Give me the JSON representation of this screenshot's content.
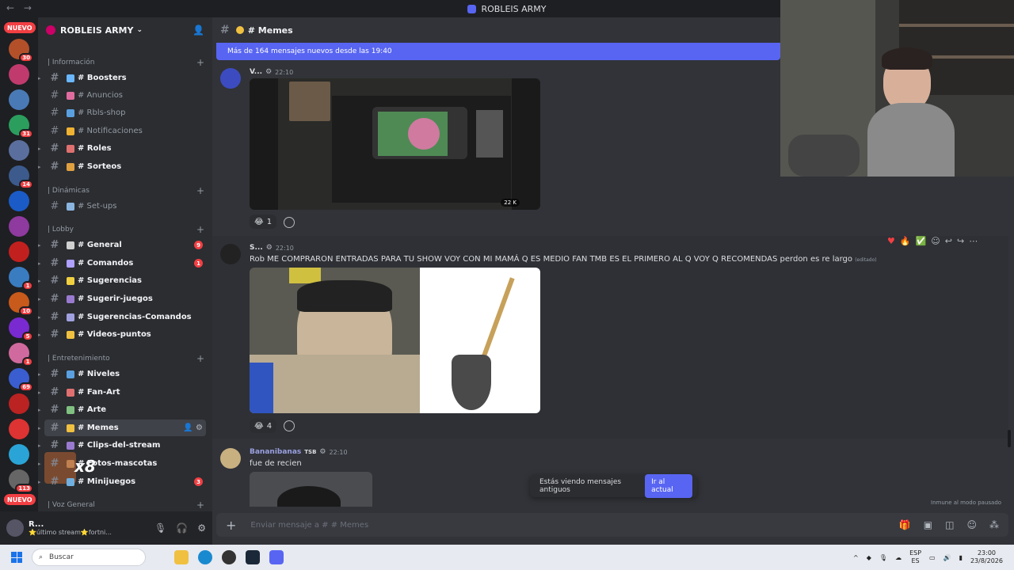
{
  "window": {
    "title": "ROBLEIS ARMY",
    "nav": "← →"
  },
  "rail": {
    "top_pill": "NUEVO",
    "bottom_pill": "NUEVO",
    "servers": [
      {
        "badge": "30",
        "color": "#b3502a"
      },
      {
        "badge": "",
        "color": "#c03a6e"
      },
      {
        "badge": "",
        "color": "#4a7ab5"
      },
      {
        "badge": "31",
        "color": "#2b9e5e"
      },
      {
        "badge": "",
        "color": "#5b6f9e"
      },
      {
        "badge": "14",
        "color": "#3c5a8c"
      },
      {
        "badge": "",
        "color": "#1b5bc7"
      },
      {
        "badge": "",
        "color": "#8e3a9e"
      },
      {
        "badge": "",
        "color": "#c2201e"
      },
      {
        "badge": "1",
        "color": "#3a7cc0"
      },
      {
        "badge": "10",
        "color": "#c85a1b"
      },
      {
        "badge": "5",
        "color": "#7a2ad1"
      },
      {
        "badge": "1",
        "color": "#d06a9e"
      },
      {
        "badge": "69",
        "color": "#3a5ed0"
      },
      {
        "badge": "",
        "color": "#b22"
      },
      {
        "badge": "",
        "color": "#d33"
      },
      {
        "badge": "",
        "color": "#2aa4d6"
      },
      {
        "badge": "113",
        "color": "#666"
      }
    ]
  },
  "guild": {
    "name": "ROBLEIS ARMY"
  },
  "categories": {
    "informacion": "| Información",
    "dinamicas": "| Dinámicas",
    "lobby": "| Lobby",
    "entretenimiento": "| Entretenimiento",
    "voz": "| Voz General"
  },
  "channels": [
    {
      "name": "# Boosters",
      "emoji": "#6ab7ff",
      "state": "unread",
      "num": ""
    },
    {
      "name": "# Anuncios",
      "emoji": "#e06c9f",
      "state": "",
      "num": ""
    },
    {
      "name": "# Rbls-shop",
      "emoji": "#5aa0e0",
      "state": "",
      "num": ""
    },
    {
      "name": "# Notificaciones",
      "emoji": "#f0b232",
      "state": "",
      "num": ""
    },
    {
      "name": "# Roles",
      "emoji": "#e07070",
      "state": "unread",
      "num": ""
    },
    {
      "name": "# Sorteos",
      "emoji": "#e0a040",
      "state": "unread",
      "num": ""
    },
    {
      "name": "# Set-ups",
      "emoji": "#8ab4e0",
      "state": "",
      "num": ""
    },
    {
      "name": "# General",
      "emoji": "#d0d0d0",
      "state": "unread",
      "num": "9"
    },
    {
      "name": "# Comandos",
      "emoji": "#b0a0ff",
      "state": "unread",
      "num": "1"
    },
    {
      "name": "# Sugerencias",
      "emoji": "#f0d040",
      "state": "unread",
      "num": ""
    },
    {
      "name": "# Sugerir-juegos",
      "emoji": "#9a7ad0",
      "state": "unread",
      "num": ""
    },
    {
      "name": "# Sugerencias-Comandos",
      "emoji": "#a0a0e0",
      "state": "unread",
      "num": ""
    },
    {
      "name": "# Videos-puntos",
      "emoji": "#f0c040",
      "state": "unread",
      "num": ""
    },
    {
      "name": "# Niveles",
      "emoji": "#5aa0e0",
      "state": "unread",
      "num": ""
    },
    {
      "name": "# Fan-Art",
      "emoji": "#e07070",
      "state": "unread",
      "num": ""
    },
    {
      "name": "# Arte",
      "emoji": "#80c080",
      "state": "unread",
      "num": ""
    },
    {
      "name": "# Memes",
      "emoji": "#f0c040",
      "state": "active",
      "num": ""
    },
    {
      "name": "# Clips-del-stream",
      "emoji": "#9a7ad0",
      "state": "unread",
      "num": ""
    },
    {
      "name": "# Fotos-mascotas",
      "emoji": "#c08050",
      "state": "unread",
      "num": ""
    },
    {
      "name": "# Minijuegos",
      "emoji": "#70b0e0",
      "state": "unread",
      "num": "3"
    }
  ],
  "overlay": {
    "multiplier": "x8"
  },
  "user": {
    "name": "R...",
    "status": "⭐último stream⭐fortni..."
  },
  "channel_header": {
    "title": "# Memes"
  },
  "new_messages_bar": "Más de 164 mensajes nuevos desde las 19:40",
  "messages": [
    {
      "author": "V...",
      "time": "22:10",
      "text": "",
      "reaction_count": "1",
      "overlay_count": "22 K"
    },
    {
      "author": "S...",
      "time": "22:10",
      "text": "Rob ME COMPRARON ENTRADAS PARA TU SHOW VOY CON MI MAMÁ Q ES MEDIO FAN TMB ES EL PRIMERO AL Q VOY Q RECOMENDAS perdon es re largo",
      "edited": "(editado)",
      "reaction_count": "4"
    },
    {
      "author": "Bananibanas",
      "tag": "TSB",
      "time": "22:10",
      "text": "fue de recien"
    }
  ],
  "old_messages": {
    "text": "Estás viendo mensajes antiguos",
    "button": "Ir al actual"
  },
  "paused_text": "Inmune al modo pausado",
  "composer": {
    "placeholder": "Enviar mensaje a # # Memes"
  },
  "taskbar": {
    "search": "Buscar",
    "lang_top": "ESP",
    "lang_bottom": "ES",
    "time": "23:00",
    "date": "23/8/2026"
  }
}
